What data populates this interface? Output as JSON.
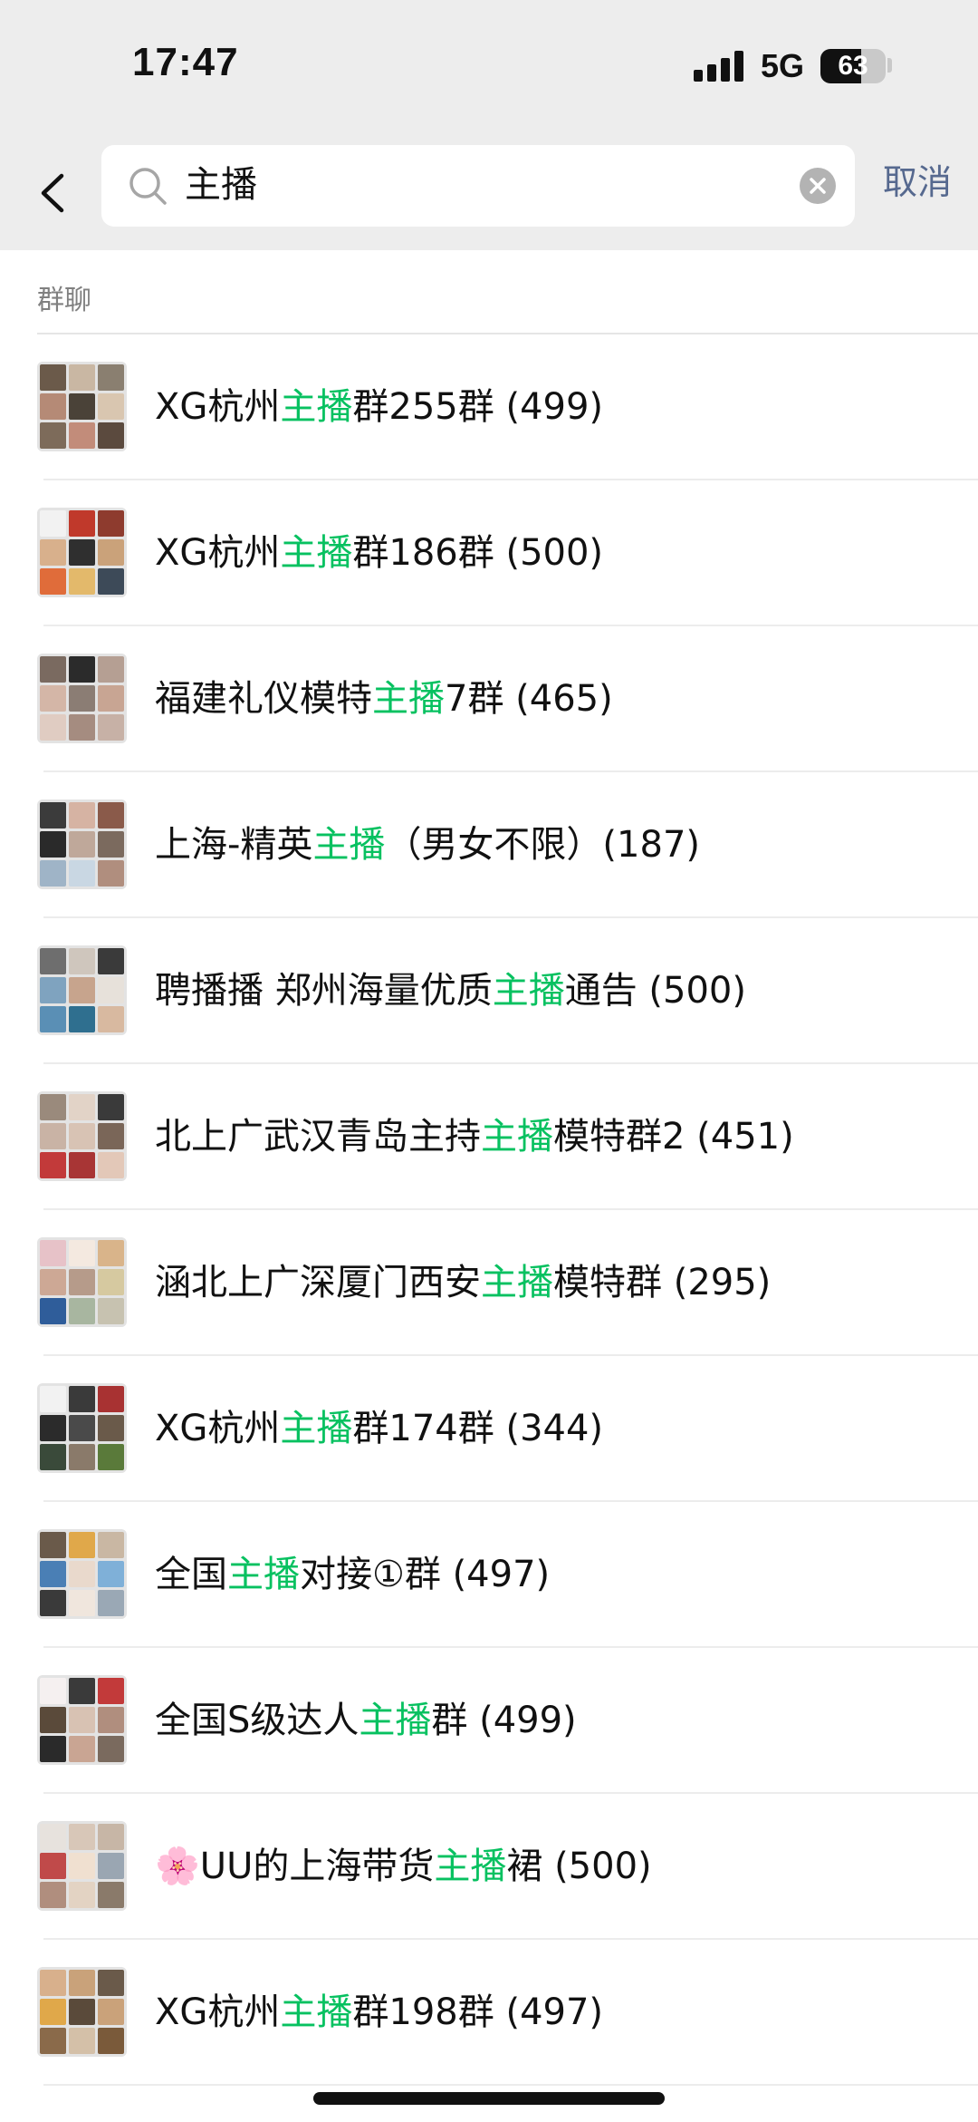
{
  "status_bar": {
    "time": "17:47",
    "network": "5G",
    "battery": "63",
    "battery_level": 0.63
  },
  "search": {
    "query": "主播",
    "cancel_label": "取消"
  },
  "section": {
    "label": "群聊"
  },
  "highlight_color": "#07c160",
  "results": [
    {
      "before": "XG杭州",
      "match": "主播",
      "after": "群255群 (499)",
      "colors": [
        "#6b5a4a",
        "#c9b7a3",
        "#8a7f70",
        "#b58a76",
        "#4a4238",
        "#d9c6b0",
        "#7d6b5a",
        "#c28c7a",
        "#5b4a3e"
      ]
    },
    {
      "before": "XG杭州",
      "match": "主播",
      "after": "群186群 (500)",
      "colors": [
        "#f2f2f2",
        "#c0392b",
        "#8e3b2e",
        "#d8b08c",
        "#2f2f2f",
        "#caa27a",
        "#e06c3a",
        "#e3b96b",
        "#3d4a58"
      ]
    },
    {
      "before": "福建礼仪模特",
      "match": "主播",
      "after": "7群 (465)",
      "colors": [
        "#7a6a60",
        "#2b2b2b",
        "#b59f93",
        "#d4b6a7",
        "#8b7d74",
        "#c8a593",
        "#e0ccc2",
        "#a58c80",
        "#c7b1a6"
      ]
    },
    {
      "before": "上海-精英",
      "match": "主播",
      "after": "（男女不限）(187)",
      "colors": [
        "#3b3b3b",
        "#d6b3a3",
        "#8a5a4a",
        "#2a2a2a",
        "#bfa89a",
        "#7b6a5e",
        "#9fb4c7",
        "#c9d7e3",
        "#b08e7e"
      ]
    },
    {
      "before": "聘播播 郑州海量优质",
      "match": "主播",
      "after": "通告 (500)",
      "colors": [
        "#6e6e6e",
        "#cfc6bd",
        "#3a3a3a",
        "#7fa3bf",
        "#c7a48d",
        "#e7e1da",
        "#5a8fb5",
        "#2f6f8f",
        "#d8b9a0"
      ]
    },
    {
      "before": "北上广武汉青岛主持",
      "match": "主播",
      "after": "模特群2 (451)",
      "colors": [
        "#9a8a7c",
        "#e2d3c7",
        "#3a3a3a",
        "#c9b3a5",
        "#d8c3b4",
        "#7a6658",
        "#c23a3a",
        "#a83535",
        "#e3c8b8"
      ]
    },
    {
      "before": "涵北上广深厦门西安",
      "match": "主播",
      "after": "模特群 (295)",
      "colors": [
        "#e7c2c8",
        "#f4e9e0",
        "#d9b48a",
        "#cda895",
        "#b69b8a",
        "#d6c9a0",
        "#2f5d9a",
        "#a8b6a0",
        "#c7c2b0"
      ]
    },
    {
      "before": "XG杭州",
      "match": "主播",
      "after": "群174群 (344)",
      "colors": [
        "#f2f2f2",
        "#3a3a3a",
        "#a83232",
        "#2b2b2b",
        "#4a4a4a",
        "#6a5a4a",
        "#3a4a3a",
        "#8a7a6a",
        "#5a7a3a"
      ]
    },
    {
      "before": "全国",
      "match": "主播",
      "after": "对接①群 (497)",
      "colors": [
        "#6a5a4a",
        "#e0a84a",
        "#c9b7a3",
        "#4a7fb5",
        "#e9d9cc",
        "#7fb0d8",
        "#3a3a3a",
        "#f0e6dd",
        "#9aa8b5"
      ]
    },
    {
      "before": "全国S级达人",
      "match": "主播",
      "after": "群 (499)",
      "colors": [
        "#f5f0f0",
        "#3a3a3a",
        "#c23a3a",
        "#5a4a3a",
        "#d8c2b3",
        "#b08e7e",
        "#2a2a2a",
        "#c9a593",
        "#7a6a5e"
      ]
    },
    {
      "before": "🌸UU的上海带货",
      "match": "主播",
      "after": "裙 (500)",
      "colors": [
        "#e7e2dd",
        "#d8c7b8",
        "#c7b6a6",
        "#c04a4a",
        "#f0e0d0",
        "#9aa6b2",
        "#b08e7e",
        "#e3d3c3",
        "#8a7a6a"
      ]
    },
    {
      "before": "XG杭州",
      "match": "主播",
      "after": "群198群 (497)",
      "colors": [
        "#d8b08c",
        "#c9a27a",
        "#6a5a4a",
        "#e0a84a",
        "#5a4a3a",
        "#caa27a",
        "#8a6a4a",
        "#d4c0a8",
        "#7a5a3a"
      ]
    }
  ]
}
